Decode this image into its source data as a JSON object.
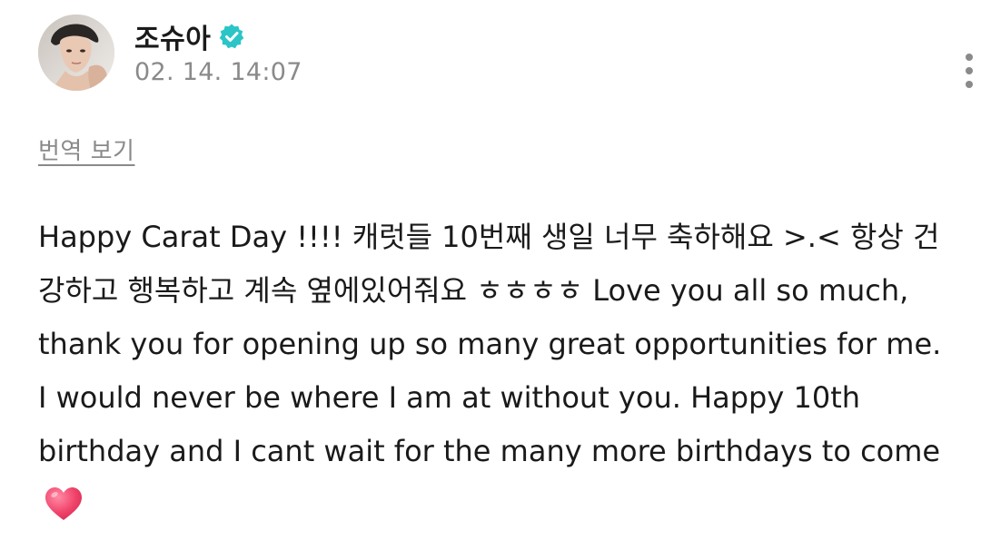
{
  "post": {
    "author": {
      "name": "조슈아",
      "verified": true,
      "avatar_icon": "profile-photo"
    },
    "timestamp": "02. 14. 14:07",
    "translate_label": "번역 보기",
    "body": "Happy Carat Day !!!! 캐럿들 10번째 생일 너무 축하해요 >.< 항상 건강하고 행복하고 계속 옆에있어줘요 ㅎㅎㅎㅎ Love you all so much, thank you for opening up so many great opportunities for me. I would never be where I am at without you. Happy 10th birthday and I cant wait for the many more birthdays to come",
    "emoji": "heart-icon"
  },
  "colors": {
    "verified_badge": "#2bc5c8",
    "secondary_text": "#8a8a8a",
    "heart": "#f0436a"
  }
}
